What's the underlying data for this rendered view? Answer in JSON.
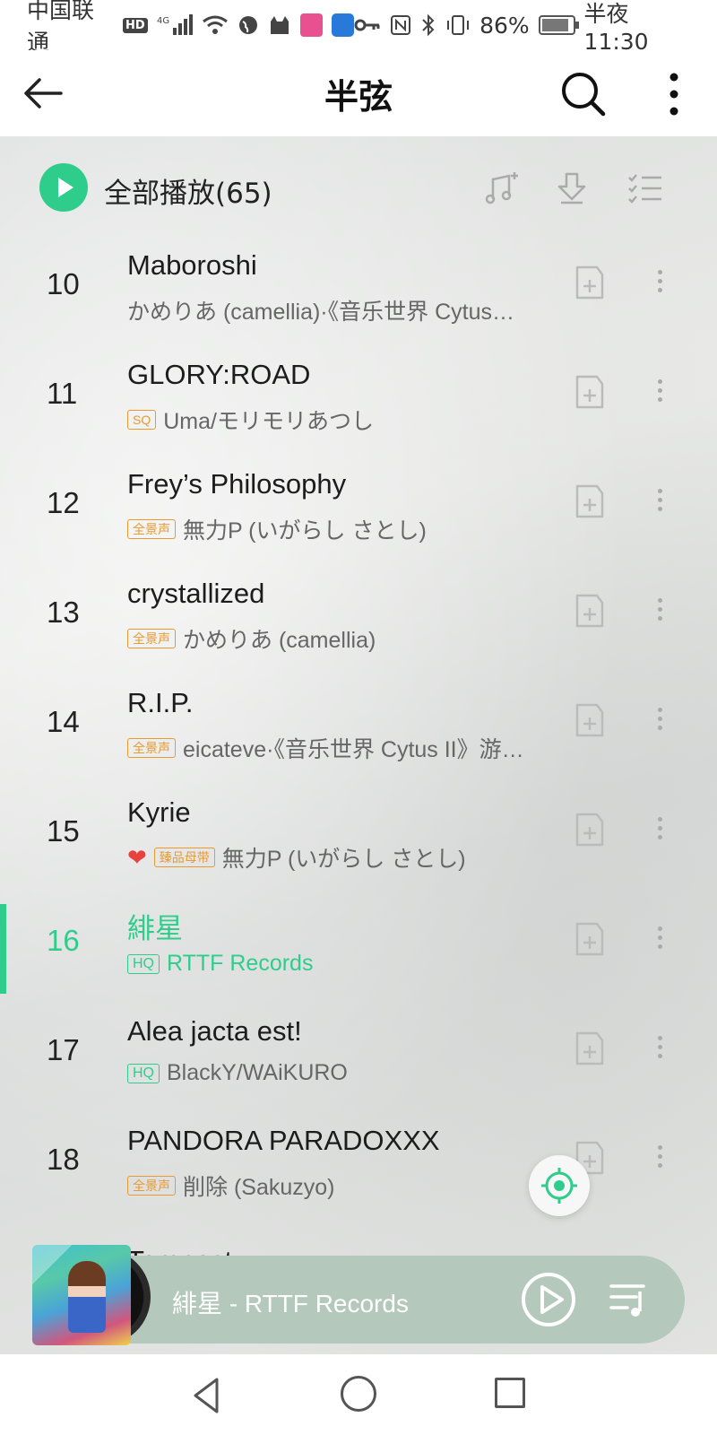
{
  "status_bar": {
    "carrier": "中国联通",
    "hd_badge": "HD",
    "network": "4G",
    "battery_percent": "86%",
    "battery_level": 0.86,
    "time": "半夜11:30"
  },
  "header": {
    "title": "半弦"
  },
  "play_all": {
    "label": "全部播放(65)"
  },
  "songs": [
    {
      "index": "10",
      "title": "Maboroshi",
      "tag": "",
      "artist": "かめりあ (camellia)·《音乐世界 Cytus…"
    },
    {
      "index": "11",
      "title": "GLORY:ROAD",
      "tag": "SQ",
      "artist": "Uma/モリモリあつし"
    },
    {
      "index": "12",
      "title": "Frey’s Philosophy",
      "tag": "全景声",
      "artist": "無力P (いがらし さとし)"
    },
    {
      "index": "13",
      "title": "crystallized",
      "tag": "全景声",
      "artist": "かめりあ (camellia)"
    },
    {
      "index": "14",
      "title": "R.I.P.",
      "tag": "全景声",
      "artist": "eicateve·《音乐世界 Cytus II》游…"
    },
    {
      "index": "15",
      "title": "Kyrie",
      "tag": "臻品母带",
      "artist": "無力P (いがらし さとし)",
      "liked": true
    },
    {
      "index": "16",
      "title": "緋星",
      "tag": "HQ",
      "artist": "RTTF Records",
      "playing": true
    },
    {
      "index": "17",
      "title": "Alea jacta est!",
      "tag": "HQ",
      "artist": "BlackY/WAiKURO"
    },
    {
      "index": "18",
      "title": "PANDORA PARADOXXX",
      "tag": "全景声",
      "artist": "削除 (Sakuzyo)"
    }
  ],
  "partial_next_title": "Tempest",
  "now_playing": {
    "text": "緋星 - RTTF Records"
  },
  "colors": {
    "accent": "#2fcd8c",
    "tag_orange": "#e79a31",
    "heart": "#e6433f",
    "player_bg": "#b4c8bc"
  }
}
